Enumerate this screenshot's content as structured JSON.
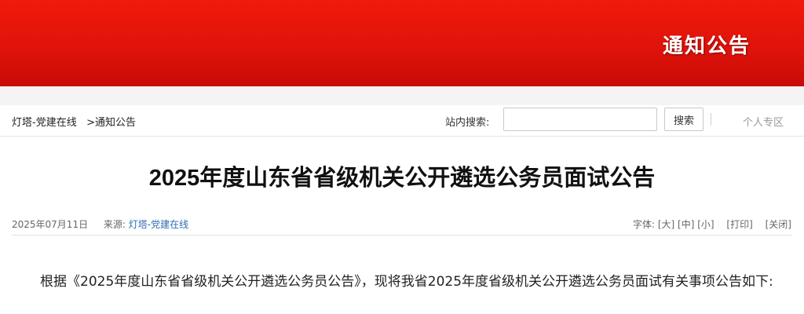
{
  "banner": {
    "title": "通知公告"
  },
  "nav": {
    "breadcrumb_home": "灯塔-党建在线",
    "breadcrumb_current": ">通知公告",
    "search_label": "站内搜索:",
    "search_placeholder": "",
    "search_button": "搜索",
    "personal": "个人专区"
  },
  "article": {
    "title": "2025年度山东省省级机关公开遴选公务员面试公告",
    "date": "2025年07月11日",
    "source_label": "来源:",
    "source": "灯塔-党建在线",
    "font_label": "字体:",
    "font_large": "[大]",
    "font_medium": "[中]",
    "font_small": "[小]",
    "print": "[打印]",
    "close": "[关闭]",
    "body": "根据《2025年度山东省省级机关公开遴选公务员公告》，现将我省2025年度省级机关公开遴选公务员面试有关事项公告如下:"
  },
  "colors": {
    "banner_red": "#e0130a",
    "link_blue": "#2b6cb3"
  }
}
